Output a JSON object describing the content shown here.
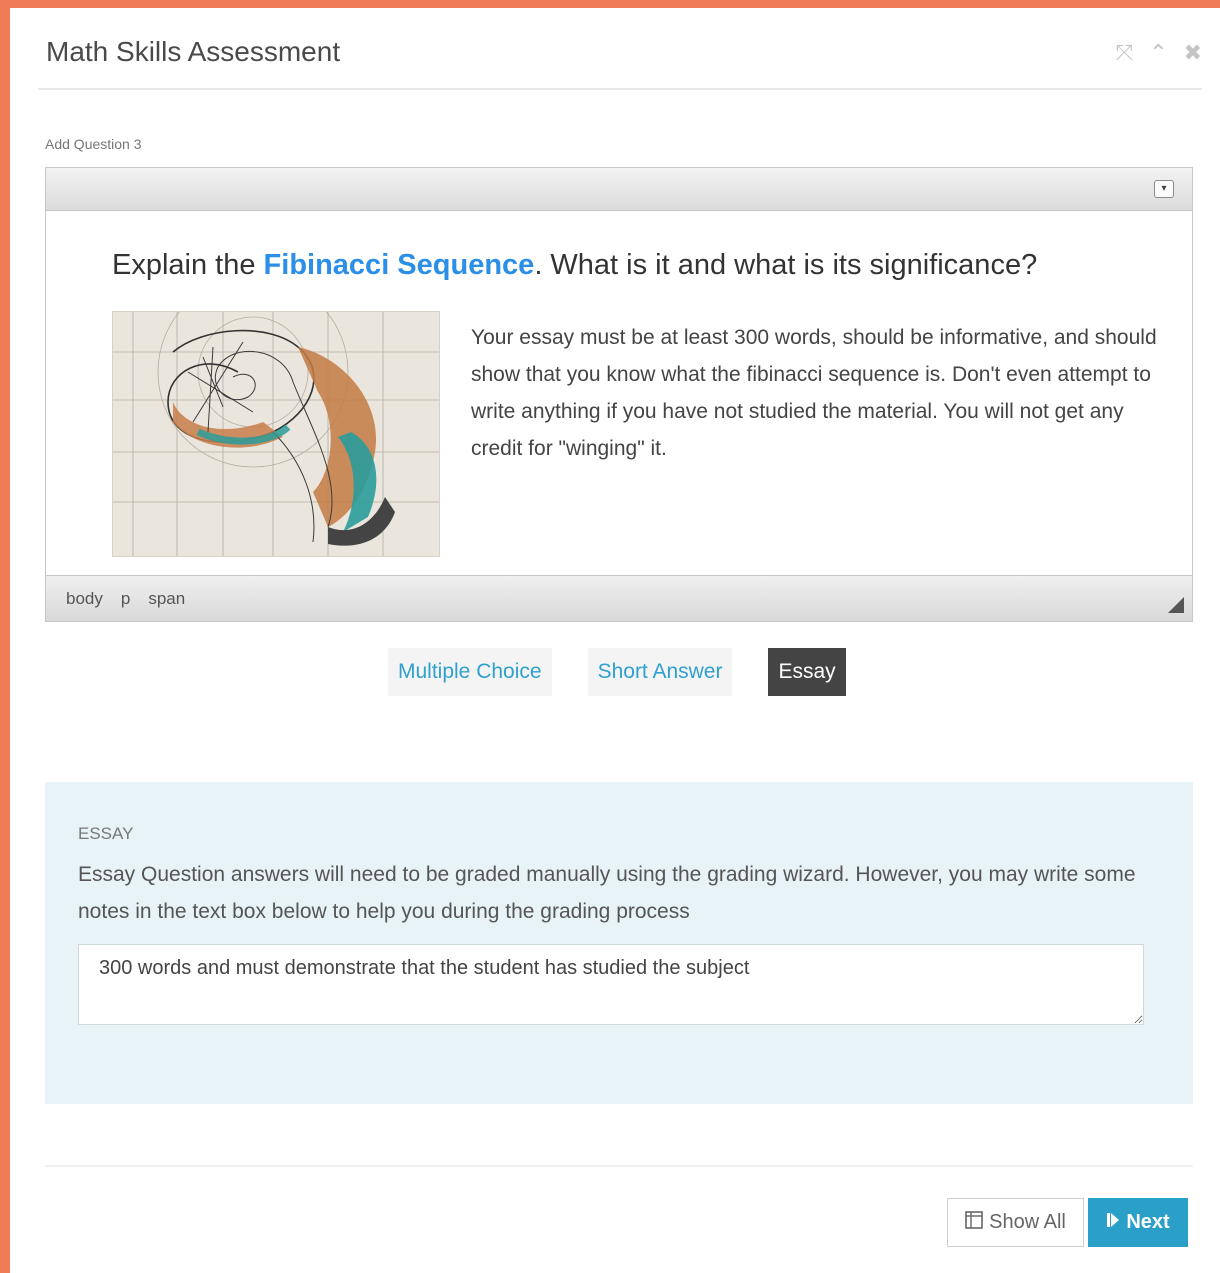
{
  "window": {
    "title": "Math Skills Assessment",
    "controls": [
      "expand-icon",
      "collapse-icon",
      "close-icon"
    ]
  },
  "add_question_label": "Add Question 3",
  "editor": {
    "heading_pre": "Explain the ",
    "heading_link": "Fibinacci Sequence",
    "heading_post": ". What is it and what is its significance?",
    "body_text": " Your essay must be at least 300 words, should be informative, and should show that you know what the fibinacci sequence is. Don't even attempt to write anything if you have not studied the material. You will not get any credit for \"winging\" it.",
    "status_path": [
      "body",
      "p",
      "span"
    ],
    "image_icon": "nautilus-spiral-drawing"
  },
  "question_types": [
    {
      "label": "Multiple Choice",
      "active": false
    },
    {
      "label": "Short Answer",
      "active": false
    },
    {
      "label": "Essay",
      "active": true
    }
  ],
  "essay": {
    "label": "ESSAY",
    "description": "Essay Question answers will need to be graded manually using the grading wizard. However, you may write some notes in the text box below to help you during the grading process",
    "notes_value": "300 words and must demonstrate that the student has studied the subject"
  },
  "footer": {
    "show_all_label": "Show All",
    "next_label": "Next"
  },
  "colors": {
    "frame": "#f07b57",
    "accent": "#2aa0c8",
    "link": "#2b8fe8",
    "essay_panel": "#e8f3f7"
  }
}
